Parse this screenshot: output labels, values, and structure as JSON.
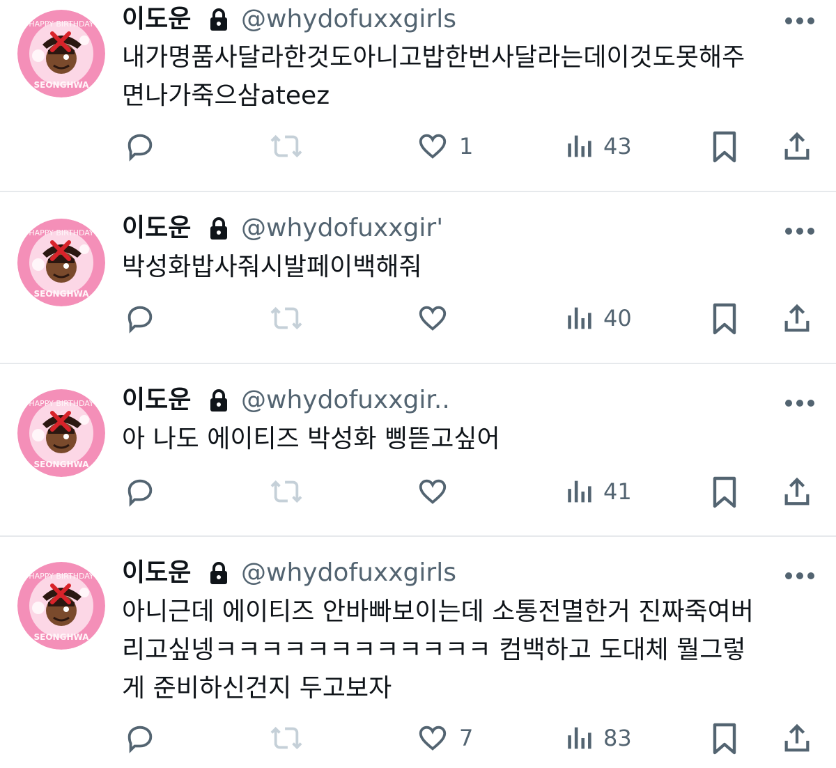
{
  "tweets": [
    {
      "name": "이도운",
      "handle": "@whydofuxxgirls",
      "text": "내가명품사달라한것도아니고밥한번사달라는데이것도못해주\n면나가죽으삼ateez",
      "likes": "1",
      "views": "43",
      "avatar_label_top": "HAPPY BIRTHDAY",
      "avatar_label_bottom": "SEONGHWA"
    },
    {
      "name": "이도운",
      "handle": "@whydofuxxgir'",
      "text": "박성화밥사줘시발페이백해줘",
      "likes": "",
      "views": "40",
      "avatar_label_top": "HAPPY BIRTHDAY",
      "avatar_label_bottom": "SEONGHWA"
    },
    {
      "name": "이도운",
      "handle": "@whydofuxxgir..",
      "text": "아 나도 에이티즈 박성화 삥뜯고싶어",
      "likes": "",
      "views": "41",
      "avatar_label_top": "HAPPY BIRTHDAY",
      "avatar_label_bottom": "SEONGHWA"
    },
    {
      "name": "이도운",
      "handle": "@whydofuxxgirls",
      "text": "아니근데 에이티즈 안바빠보이는데 소통전멸한거 진짜죽여버\n리고싶넹ㅋㅋㅋㅋㅋㅋㅋㅋㅋㅋㅋㅋ 컴백하고 도대체 뭘그렇\n게 준비하신건지 두고보자",
      "likes": "7",
      "views": "83",
      "avatar_label_top": "HAPPY BIRTHDAY",
      "avatar_label_bottom": "SEONGHWA"
    }
  ],
  "icons": {
    "reply": "reply-icon",
    "retweet": "retweet-icon",
    "like": "heart-icon",
    "views": "views-icon",
    "bookmark": "bookmark-icon",
    "share": "share-icon",
    "lock": "lock-icon",
    "more": "more-icon"
  },
  "colors": {
    "text": "#0f1419",
    "secondary": "#536471",
    "retweet_disabled": "#c5d0d8",
    "divider": "#e6e9ec",
    "avatar_pink": "#f48fb8"
  }
}
